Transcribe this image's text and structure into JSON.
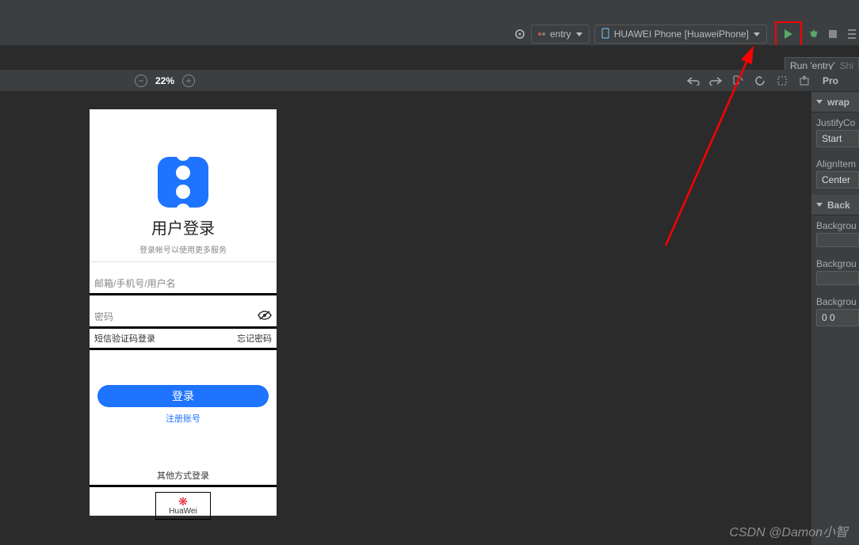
{
  "toolbar": {
    "entry_label": "entry",
    "device_label": "HUAWEI Phone [HuaweiPhone]"
  },
  "tooltip": {
    "text": "Run 'entry'",
    "shortcut": "Shi"
  },
  "zoom": {
    "value": "22%"
  },
  "phone": {
    "title": "用户登录",
    "subtitle": "登录帐号以使用更多服务",
    "email_placeholder": "邮箱/手机号/用户名",
    "password_placeholder": "密码",
    "sms_login": "短信验证码登录",
    "forgot": "忘记密码",
    "login_btn": "登录",
    "register": "注册账号",
    "other_login": "其他方式登录",
    "huawei_label": "HuaWei"
  },
  "props": {
    "panel_title": "Pro",
    "section1": "wrap",
    "justify_label": "JustifyCo",
    "justify_value": "Start",
    "align_label": "AlignItem",
    "align_value": "Center",
    "section2": "Back",
    "bg1_label": "Backgrou",
    "bg2_label": "Backgrou",
    "bg3_label": "Backgrou",
    "bg3_value": "0 0"
  },
  "watermark": "CSDN @Damon小智"
}
